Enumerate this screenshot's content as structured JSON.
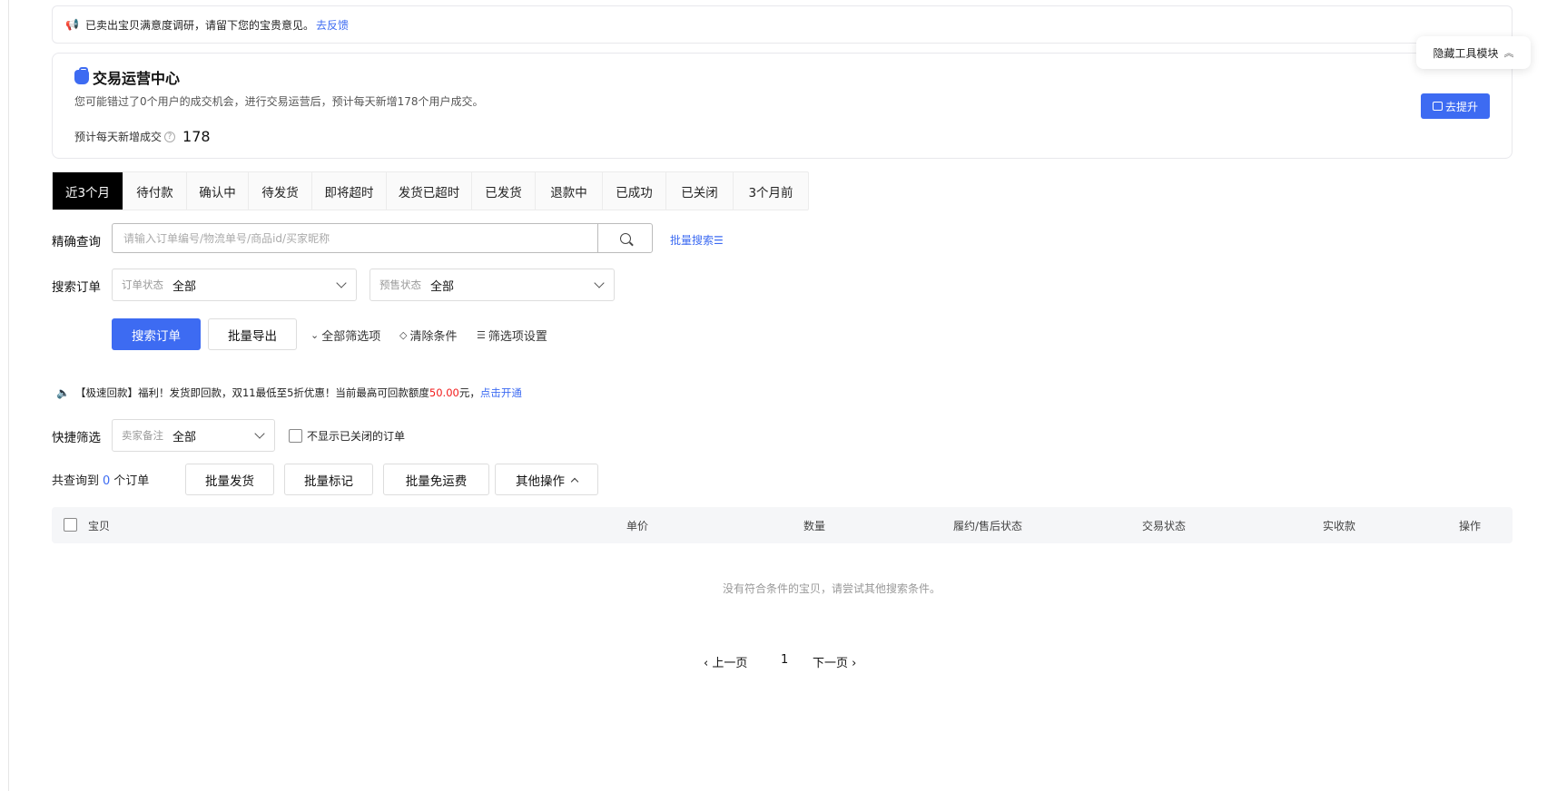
{
  "notice": {
    "text": "已卖出宝贝满意度调研，请留下您的宝贵意见。",
    "link": "去反馈"
  },
  "ops_center": {
    "title": "交易运营中心",
    "description": "您可能错过了0个用户的成交机会，进行交易运营后，预计每天新增178个用户成交。",
    "stat_label": "预计每天新增成交",
    "stat_value": "178",
    "button": "去提升"
  },
  "hide_tool": {
    "label": "隐藏工具模块"
  },
  "tabs": [
    {
      "label": "近3个月",
      "active": true
    },
    {
      "label": "待付款"
    },
    {
      "label": "确认中"
    },
    {
      "label": "待发货"
    },
    {
      "label": "即将超时"
    },
    {
      "label": "发货已超时"
    },
    {
      "label": "已发货"
    },
    {
      "label": "退款中"
    },
    {
      "label": "已成功"
    },
    {
      "label": "已关闭"
    },
    {
      "label": "3个月前"
    }
  ],
  "precise_search": {
    "label": "精确查询",
    "placeholder": "请输入订单编号/物流单号/商品id/买家昵称",
    "value": "",
    "batch_link": "批量搜索"
  },
  "filter": {
    "label": "搜索订单",
    "order_status": {
      "prefix": "订单状态",
      "value": "全部"
    },
    "presale_status": {
      "prefix": "预售状态",
      "value": "全部"
    }
  },
  "actions": {
    "search": "搜索订单",
    "export": "批量导出",
    "all_filters": "全部筛选项",
    "clear": "清除条件",
    "filter_settings": "筛选项设置"
  },
  "promo": {
    "prefix": "【极速回款】福利！发货即回款，双11最低至5折优惠！当前最高可回款额度",
    "amount": "50.00",
    "suffix": "元，",
    "link": "点击开通"
  },
  "quick_filter": {
    "label": "快捷筛选",
    "seller_note": {
      "prefix": "卖家备注",
      "value": "全部"
    },
    "hide_closed": "不显示已关闭的订单"
  },
  "result": {
    "prefix": "共查询到",
    "count": "0",
    "suffix": "个订单"
  },
  "bulk": {
    "ship": "批量发货",
    "mark": "批量标记",
    "free_shipping": "批量免运费",
    "other": "其他操作"
  },
  "table": {
    "columns": [
      "宝贝",
      "单价",
      "数量",
      "履约/售后状态",
      "交易状态",
      "实收款",
      "操作"
    ],
    "empty": "没有符合条件的宝贝，请尝试其他搜索条件。"
  },
  "pagination": {
    "prev": "上一页",
    "current": "1",
    "next": "下一页"
  },
  "colors": {
    "accent": "#3d6bf2",
    "active_tab": "#000000",
    "amount": "#f21b1b"
  }
}
